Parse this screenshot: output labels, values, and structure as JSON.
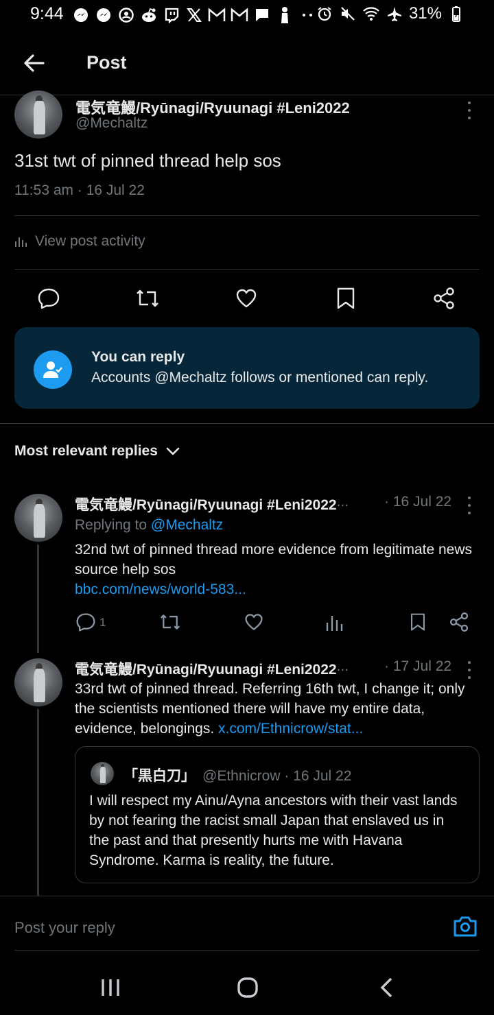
{
  "status_bar": {
    "time": "9:44",
    "battery": "31%",
    "icons": [
      "messenger-icon",
      "messenger-icon",
      "account-icon",
      "reddit-icon",
      "twitch-icon",
      "x-icon",
      "gmail-icon",
      "gmail-icon",
      "chat-icon",
      "figure-icon",
      "more-icon"
    ],
    "right_icons": [
      "alarm-icon",
      "mute-icon",
      "wifi-icon",
      "airplane-icon",
      "battery-icon"
    ]
  },
  "header": {
    "title": "Post"
  },
  "post": {
    "author_name": "電気竜鰻/Ryūnagi/Ryuunagi #Leni2022",
    "author_handle": "@Mechaltz",
    "text": "31st twt of pinned thread help sos",
    "timestamp": "11:53 am · 16 Jul 22",
    "activity_label": "View post activity"
  },
  "reply_restriction": {
    "title": "You can reply",
    "text": "Accounts @Mechaltz follows or mentioned can reply."
  },
  "replies_sort": {
    "label": "Most relevant replies"
  },
  "replies": [
    {
      "author_name": "電気竜鰻/Ryūnagi/Ryuunagi #Leni2022",
      "ellipsis": " ...",
      "date": "· 16 Jul 22",
      "replying_prefix": "Replying to ",
      "replying_mention": "@Mechaltz",
      "text": "32nd twt of pinned thread more evidence from legitimate news source help sos",
      "link": "bbc.com/news/world-583...",
      "reply_count": "1"
    },
    {
      "author_name": "電気竜鰻/Ryūnagi/Ryuunagi #Leni2022",
      "ellipsis": " ...",
      "date": "· 17 Jul 22",
      "text": "33rd twt of pinned thread. Referring 16th twt, I change it; only the scientists mentioned there will have my entire data, evidence, belongings. ",
      "link": "x.com/Ethnicrow/stat...",
      "quote": {
        "author_name": "「黒白刀」",
        "author_meta": "@Ethnicrow · 16 Jul 22",
        "text": "I will respect my Ainu/Ayna ancestors with their vast lands by not fearing the racist small Japan that enslaved us in the past and that presently hurts me with Havana Syndrome. Karma is reality, the future."
      }
    }
  ],
  "compose": {
    "placeholder": "Post your reply"
  },
  "colors": {
    "accent": "#1d9bf0",
    "muted": "#71767b",
    "text": "#e7e9ea",
    "card_bg": "#06273a",
    "divider": "#2f3336"
  }
}
